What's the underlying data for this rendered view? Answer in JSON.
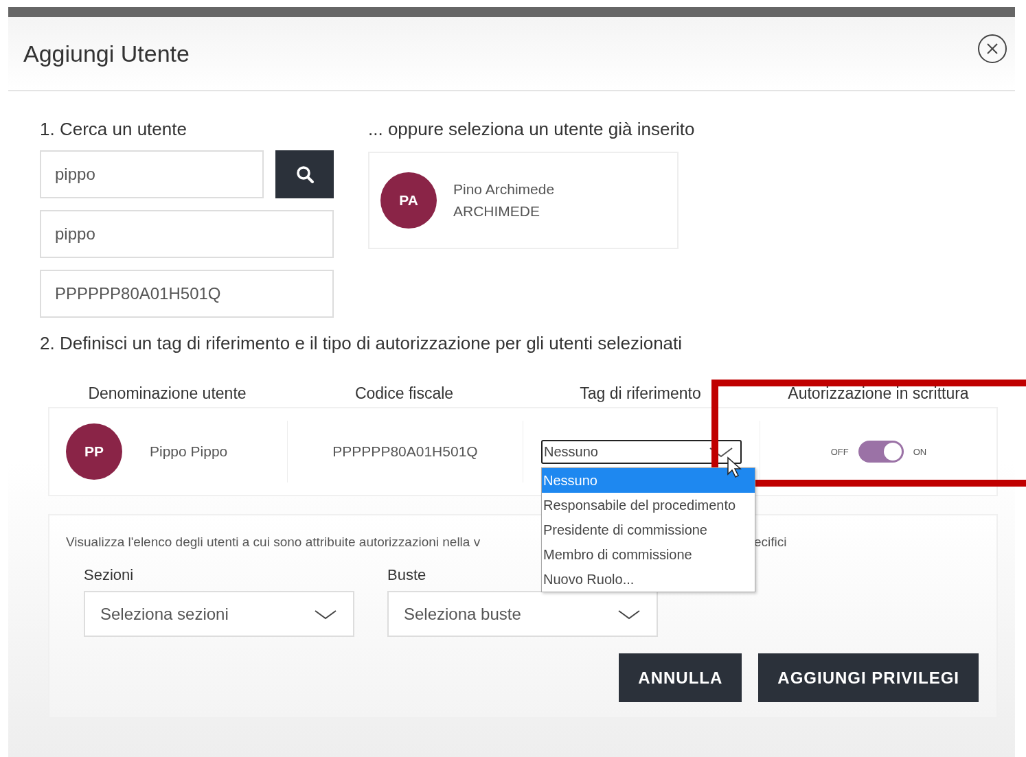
{
  "dialog": {
    "title": "Aggiungi Utente"
  },
  "search": {
    "heading": "1. Cerca un utente",
    "query": "pippo",
    "first_name": "pippo",
    "tax_code": "PPPPPP80A01H501Q"
  },
  "existing": {
    "heading": "... oppure seleziona un utente già inserito",
    "users": [
      {
        "initials": "PA",
        "name": "Pino Archimede",
        "surname": "ARCHIMEDE"
      }
    ]
  },
  "permissions": {
    "heading": "2. Definisci un tag di riferimento e il tipo di autorizzazione per gli utenti selezionati",
    "columns": [
      "Denominazione utente",
      "Codice fiscale",
      "Tag di riferimento",
      "Autorizzazione in scrittura"
    ],
    "rows": [
      {
        "initials": "PP",
        "name": "Pippo Pippo",
        "tax_code": "PPPPPP80A01H501Q",
        "tag": "Nessuno",
        "write_off_label": "OFF",
        "write_on_label": "ON",
        "write": true
      }
    ],
    "tag_options": [
      {
        "label": "Nessuno",
        "selected": true
      },
      {
        "label": "Responsabile del procedimento",
        "selected": false
      },
      {
        "label": "Presidente di commissione",
        "selected": false
      },
      {
        "label": "Membro di commissione",
        "selected": false
      },
      {
        "label": "Nuovo Ruolo...",
        "selected": false
      }
    ]
  },
  "filters": {
    "info_start": "Visualizza l'elenco degli utenti a cui sono attribuite autorizzazioni nella v",
    "info_end": "ecifici",
    "fields": [
      {
        "label": "Sezioni",
        "placeholder": "Seleziona sezioni"
      },
      {
        "label": "Buste",
        "placeholder": "Seleziona buste"
      }
    ]
  },
  "buttons": [
    "ANNULLA",
    "AGGIUNGI PRIVILEGI"
  ]
}
